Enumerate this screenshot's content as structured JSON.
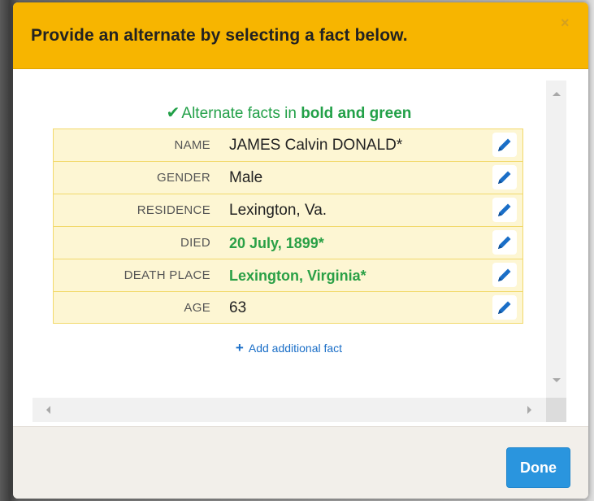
{
  "modal": {
    "title": "Provide an alternate by selecting a fact below.",
    "close_label": "×",
    "legend": {
      "check": "✔",
      "text_prefix": "Alternate facts in ",
      "text_bold": "bold and green"
    },
    "facts": [
      {
        "label": "NAME",
        "value": "JAMES Calvin DONALD*",
        "alternate": false
      },
      {
        "label": "GENDER",
        "value": "Male",
        "alternate": false
      },
      {
        "label": "RESIDENCE",
        "value": "Lexington, Va.",
        "alternate": false
      },
      {
        "label": "DIED",
        "value": "20 July, 1899*",
        "alternate": true
      },
      {
        "label": "DEATH PLACE",
        "value": "Lexington, Virginia*",
        "alternate": true
      },
      {
        "label": "AGE",
        "value": "63",
        "alternate": false
      }
    ],
    "add_fact": {
      "plus": "+",
      "label": "Add additional fact"
    },
    "done_label": "Done"
  },
  "colors": {
    "header": "#f7b500",
    "alternate_text": "#2aa046",
    "link": "#1a6ec7",
    "primary_button": "#2a95de",
    "edit_icon": "#1a6ec7"
  },
  "icons": {
    "edit": "pencil-icon",
    "close": "close-icon",
    "check": "check-icon",
    "add": "plus-icon"
  }
}
